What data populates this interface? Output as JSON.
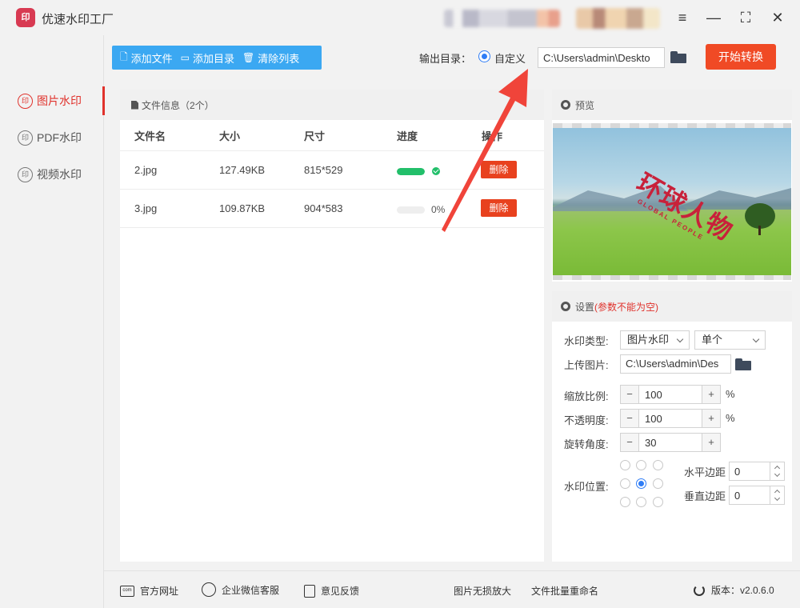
{
  "app": {
    "title": "优速水印工厂",
    "logo_text": "印"
  },
  "window": {
    "menu": "≡",
    "minimize": "—",
    "maximize": "⛶",
    "close": "✕"
  },
  "sidebar": {
    "items": [
      {
        "label": "图片水印",
        "active": true
      },
      {
        "label": "PDF水印",
        "active": false
      },
      {
        "label": "视频水印",
        "active": false
      }
    ]
  },
  "toolbar": {
    "add_file": "添加文件",
    "add_dir": "添加目录",
    "clear_list": "清除列表"
  },
  "output": {
    "label": "输出目录：",
    "radio_label": "自定义",
    "path": "C:\\Users\\admin\\Deskto"
  },
  "start_button": "开始转换",
  "file_panel": {
    "title": "文件信息（2个）",
    "columns": [
      "文件名",
      "大小",
      "尺寸",
      "进度",
      "操作"
    ],
    "rows": [
      {
        "name": "2.jpg",
        "size": "127.49KB",
        "dims": "815*529",
        "progress": 100,
        "progress_text": "",
        "action": "删除"
      },
      {
        "name": "3.jpg",
        "size": "109.87KB",
        "dims": "904*583",
        "progress": 0,
        "progress_text": "0%",
        "action": "删除"
      }
    ]
  },
  "preview": {
    "title": "预览",
    "watermark_text": "环球人物",
    "watermark_sub": "GLOBAL PEOPLE"
  },
  "settings": {
    "title": "设置",
    "warning": "(参数不能为空)",
    "watermark_type_label": "水印类型:",
    "watermark_type": "图片水印",
    "watermark_mode": "单个",
    "upload_label": "上传图片:",
    "upload_path": "C:\\Users\\admin\\Des",
    "scale_label": "缩放比例:",
    "scale": "100",
    "opacity_label": "不透明度:",
    "opacity": "100",
    "rotate_label": "旋转角度:",
    "rotate": "30",
    "unit_percent": "%",
    "position_label": "水印位置:",
    "position_selected": "center",
    "h_margin_label": "水平边距",
    "h_margin": "0",
    "v_margin_label": "垂直边距",
    "v_margin": "0",
    "minus": "−",
    "plus": "+"
  },
  "footer": {
    "website": "官方网址",
    "wechat": "企业微信客服",
    "feedback": "意见反馈",
    "enlarge": "图片无损放大",
    "rename": "文件批量重命名",
    "version": "版本：v2.0.6.0"
  },
  "colors": {
    "accent_red": "#f04a25",
    "toolbar_blue": "#3ba8f2",
    "progress_green": "#22bf6a",
    "radio_blue": "#2f7df6"
  }
}
